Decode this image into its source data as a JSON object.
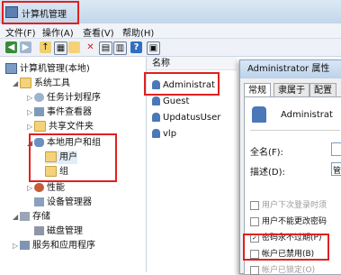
{
  "window": {
    "title": "计算机管理"
  },
  "menu": [
    "文件(F)",
    "操作(A)",
    "查看(V)",
    "帮助(H)"
  ],
  "tree": {
    "root": "计算机管理(本地)",
    "items": [
      {
        "label": "系统工具"
      },
      {
        "label": "任务计划程序"
      },
      {
        "label": "事件查看器"
      },
      {
        "label": "共享文件夹"
      },
      {
        "label": "本地用户和组"
      },
      {
        "label": "用户"
      },
      {
        "label": "组"
      },
      {
        "label": "性能"
      },
      {
        "label": "设备管理器"
      },
      {
        "label": "存储"
      },
      {
        "label": "磁盘管理"
      },
      {
        "label": "服务和应用程序"
      }
    ]
  },
  "list": {
    "column": "名称",
    "rows": [
      "Administrat",
      "Guest",
      "UpdatusUser",
      "vlp"
    ],
    "extra": "Up"
  },
  "dialog": {
    "title": "Administrator 属性",
    "tabs": [
      "常规",
      "隶属于",
      "配置"
    ],
    "username": "Administrat",
    "full_name_label": "全名(F):",
    "desc_label": "描述(D):",
    "desc_value": "管",
    "checkboxes": [
      {
        "label": "用户下次登录时须",
        "checked": false,
        "disabled": true
      },
      {
        "label": "用户不能更改密码",
        "checked": false,
        "disabled": false
      },
      {
        "label": "密码永不过期(P)",
        "checked": true,
        "disabled": false
      },
      {
        "label": "帐户已禁用(B)",
        "checked": false,
        "disabled": false
      },
      {
        "label": "帐户已锁定(O)",
        "checked": false,
        "disabled": true
      }
    ]
  }
}
